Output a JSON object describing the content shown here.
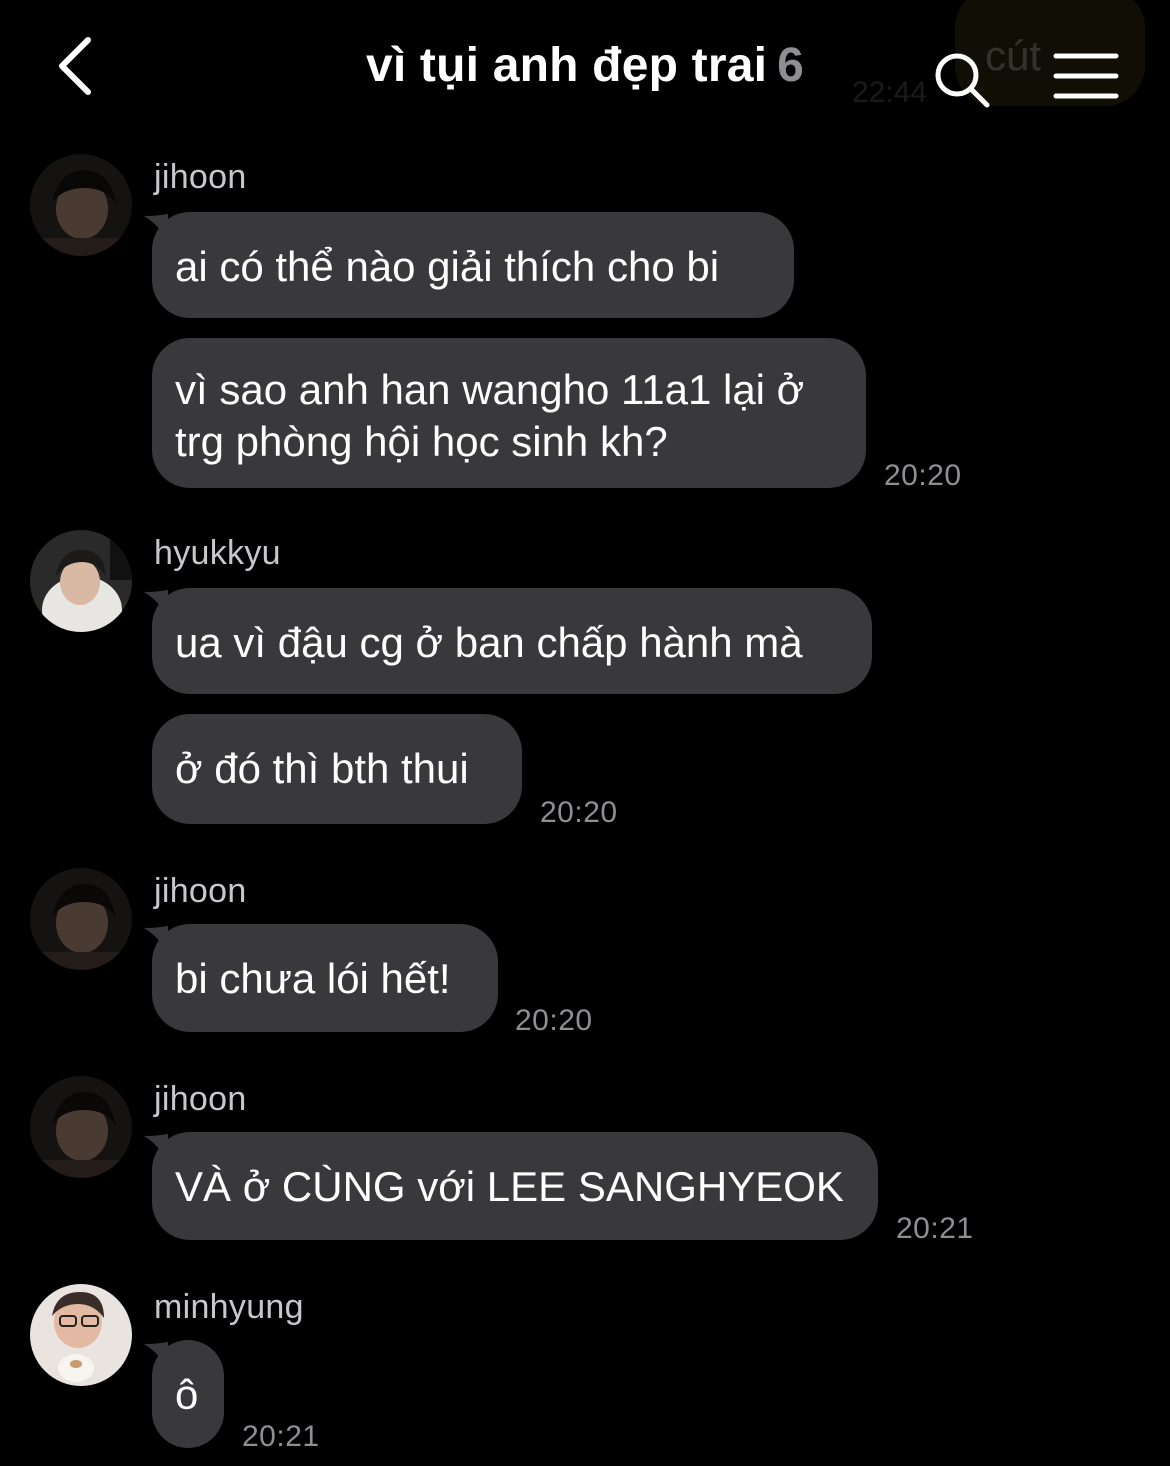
{
  "header": {
    "title": "vì tụi anh đẹp trai",
    "member_count": "6",
    "back_icon": "chevron-left-icon",
    "search_icon": "search-icon",
    "menu_icon": "hamburger-menu-icon"
  },
  "overlay": {
    "ghost_text": "cút",
    "ghost_time": "22:44"
  },
  "colors": {
    "background": "#000000",
    "bubble": "#39393c",
    "timestamp": "#8e8e93",
    "username": "#c7c7cc"
  },
  "messages": [
    {
      "sender": "jihoon",
      "bubbles": [
        "ai có thể nào giải thích cho bi",
        "vì sao anh han wangho 11a1 lại ở trg phòng hội học sinh kh?"
      ],
      "time": "20:20"
    },
    {
      "sender": "hyukkyu",
      "bubbles": [
        "ua vì đậu cg ở ban chấp hành mà",
        "ở đó thì bth thui"
      ],
      "time": "20:20"
    },
    {
      "sender": "jihoon",
      "bubbles": [
        "bi chưa lói hết!"
      ],
      "time": "20:20"
    },
    {
      "sender": "jihoon",
      "bubbles": [
        "VÀ ở CÙNG với LEE SANGHYEOK"
      ],
      "time": "20:21"
    },
    {
      "sender": "minhyung",
      "bubbles": [
        "ô"
      ],
      "time": "20:21"
    }
  ]
}
